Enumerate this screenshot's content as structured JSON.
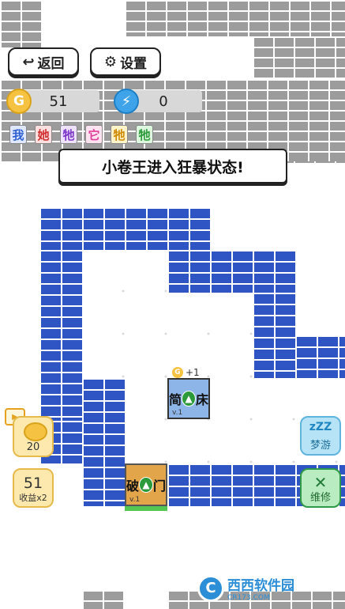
{
  "header": {
    "back_label": "返回",
    "settings_label": "设置"
  },
  "resources": {
    "coins": "51",
    "energy": "0",
    "coin_symbol": "G"
  },
  "tags": [
    {
      "label": "我",
      "color": "#2f5fd0",
      "bg": "#dfe8ff"
    },
    {
      "label": "她",
      "color": "#d12f2f",
      "bg": "#ffe0e0"
    },
    {
      "label": "牠",
      "color": "#7b36c9",
      "bg": "#efe2ff"
    },
    {
      "label": "它",
      "color": "#e0409a",
      "bg": "#ffe3f1"
    },
    {
      "label": "牠",
      "color": "#d08a00",
      "bg": "#fff3c9"
    },
    {
      "label": "牠",
      "color": "#2c9a3a",
      "bg": "#ddf7de"
    }
  ],
  "banner": "小卷王进入狂暴状态!",
  "board": {
    "bed": {
      "label_left": "简",
      "label_right": "床",
      "level": "v.1",
      "bonus": "+1"
    },
    "door": {
      "label_left": "破",
      "label_right": "门",
      "level": "v.1"
    }
  },
  "left_panel": {
    "video_reward": "20",
    "collect_value": "51",
    "collect_label": "收益x2"
  },
  "right_panel": {
    "dream_label": "梦游",
    "repair_label": "维修"
  },
  "watermark": {
    "text": "西西软件园",
    "url": "CR173.COM"
  }
}
